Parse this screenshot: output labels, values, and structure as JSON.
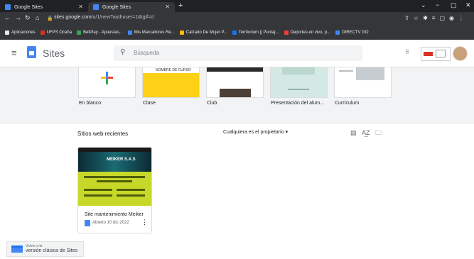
{
  "browser": {
    "tabs": [
      {
        "title": "Google Sites"
      },
      {
        "title": "Google Sites"
      }
    ],
    "new_tab": "+",
    "window_controls": [
      "⌄",
      "−",
      "▢",
      "✕"
    ],
    "url_host": "sites.google.com",
    "url_path": "/u/1/new?authuser=1&tgif=d",
    "bookmarks": [
      {
        "label": "Aplicaciones",
        "color": "#e8eaed"
      },
      {
        "label": "UFPS Ocaña",
        "color": "#d93025"
      },
      {
        "label": "BetPlay - Apuestas...",
        "color": "#34a853"
      },
      {
        "label": "Mis Marcadores Re...",
        "color": "#4285f4"
      },
      {
        "label": "Calzado De Mujer P...",
        "color": "#fbbc04"
      },
      {
        "label": "Territorium || Puntaj...",
        "color": "#1a73e8"
      },
      {
        "label": "Deportes en vivo, p...",
        "color": "#ea4335"
      },
      {
        "label": "DIRECTV GO",
        "color": "#4285f4"
      }
    ]
  },
  "header": {
    "brand": "Sites",
    "search_placeholder": "Búsqueda"
  },
  "templates": [
    {
      "label": "En blanco",
      "style": "blank"
    },
    {
      "label": "Clase",
      "style": "yellow",
      "heading": "NOMBRE DE CURSO"
    },
    {
      "label": "Club",
      "style": "photo"
    },
    {
      "label": "Presentación del alum...",
      "style": "teal"
    },
    {
      "label": "Currículum",
      "style": "white"
    }
  ],
  "recent": {
    "title": "Sitios web recientes",
    "owner_filter": "Cualquiera es el propietario",
    "sites": [
      {
        "name": "Site mantenimiento Meiker",
        "opened": "Abierto 10 dic 2022",
        "thumb_title": "MEIKER S.A.S"
      }
    ]
  },
  "classic": {
    "line1": "Volver a la",
    "line2": "versión clásica de Sites"
  },
  "colors": {
    "accent": "#4285f4",
    "chrome_dark": "#202124"
  }
}
